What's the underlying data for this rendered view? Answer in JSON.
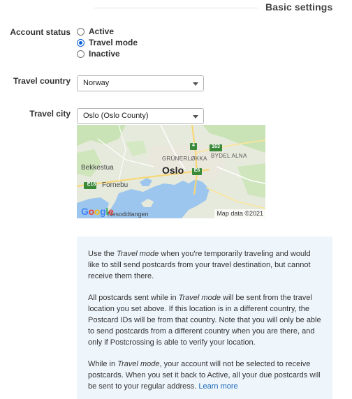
{
  "section": {
    "title": "Basic settings"
  },
  "account_status": {
    "label": "Account status",
    "options": [
      {
        "label": "Active",
        "checked": false
      },
      {
        "label": "Travel mode",
        "checked": true
      },
      {
        "label": "Inactive",
        "checked": false
      }
    ]
  },
  "travel_country": {
    "label": "Travel country",
    "value": "Norway"
  },
  "travel_city": {
    "label": "Travel city",
    "value": "Oslo (Oslo County)"
  },
  "map": {
    "labels": {
      "oslo": "Oslo",
      "grunerlokka": "GRÜNERLØKKA",
      "bydel_alna": "BYDEL ALNA",
      "bekkestua": "Bekkestua",
      "fornebu": "Fornebu",
      "nesoddtangen": "Nesoddtangen"
    },
    "road_shields": {
      "e18": "E18",
      "e6": "E6",
      "r4": "4",
      "r163": "163"
    },
    "attribution": "Map data ©2021",
    "logo": "Google"
  },
  "info": {
    "p1_a": "Use the ",
    "p1_em": "Travel mode",
    "p1_b": " when you're temporarily traveling and would like to still send postcards from your travel destination, but cannot receive them there.",
    "p2_a": "All postcards sent while in ",
    "p2_em": "Travel mode",
    "p2_b": " will be sent from the travel location you set above. If this location is in a different country, the Postcard IDs will be from that country. Note that you will only be able to send postcards from a different country when you are there, and only if Postcrossing is able to verify your location.",
    "p3_a": "While in ",
    "p3_em": "Travel mode",
    "p3_b": ", your account will not be selected to receive postcards. When you set it back to Active, all your due postcards will be sent to your regular address. ",
    "learn_more": "Learn more"
  }
}
